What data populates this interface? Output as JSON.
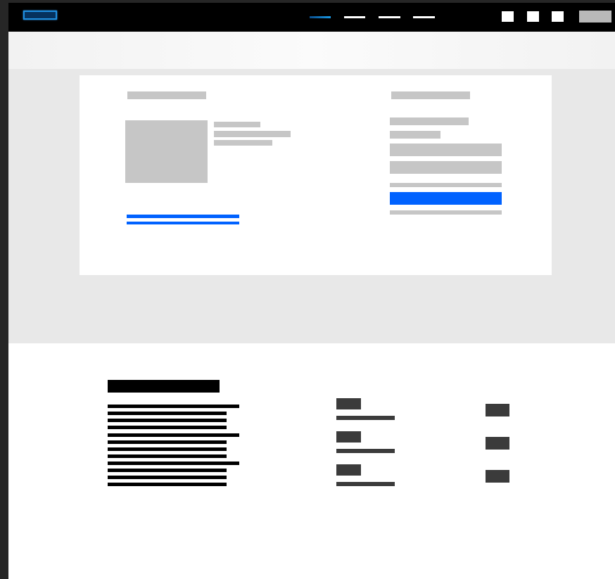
{
  "header": {
    "logo_icon": "brand-logo-icon",
    "nav": [
      {
        "state": "active"
      },
      {
        "state": "default"
      },
      {
        "state": "default"
      },
      {
        "state": "default"
      }
    ],
    "actions": [
      "search-icon",
      "notification-icon",
      "user-icon"
    ],
    "colors": {
      "bar": "#000000",
      "accent": "#1a9be6"
    }
  },
  "card": {
    "accent_color": "#0062ff",
    "left_panel": {
      "image_icon": "product-image-placeholder"
    },
    "right_panel": {
      "button_color": "#0062ff"
    }
  },
  "footer": {
    "link_columns": 2
  }
}
